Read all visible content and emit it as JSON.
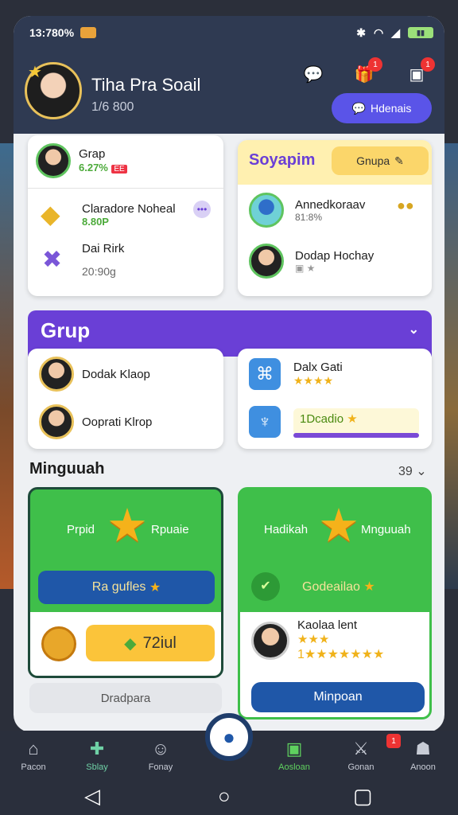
{
  "status_bar": {
    "time": "13:780%"
  },
  "profile": {
    "name": "Tiha Pra Soail",
    "subtitle": "1/6 800"
  },
  "header": {
    "action_label": "Hdenais",
    "badge_a": "1",
    "badge_b": "1"
  },
  "card_a": {
    "user_name": "Grap",
    "user_stat": "6.27%",
    "user_tag": "EE",
    "item1_title": "Claradore Noheal",
    "item1_sub": "8.80P",
    "item2_title": "Dai Rirk",
    "item2_sub": "20:90g"
  },
  "card_b": {
    "title": "Soyapim",
    "button": "Gnupa",
    "row1_name": "Annedkoraav",
    "row1_stat": "81:8%",
    "row2_name": "Dodap Hochay"
  },
  "group": {
    "title": "Grup",
    "members": [
      "Dodak Klaop",
      "Ooprati Klrop"
    ],
    "item1_title": "Dalx Gati",
    "item1_rating": "★★★★",
    "item2_title": "1Dcadio"
  },
  "section": {
    "title": "Minguuah",
    "count": "39"
  },
  "reward_left": {
    "label_left": "Prpid",
    "label_right": "Rpuaie",
    "button": "Ra gufles",
    "value": "72iul",
    "bottom_button": "Dradpara"
  },
  "reward_right": {
    "label_left": "Hadikah",
    "label_right": "Mnguuah",
    "subtitle": "Godeailao",
    "user_name": "Kaolaa lent",
    "rating_small": "★★★",
    "rating_row": "1★★★★★★★",
    "button": "Minpoan"
  },
  "nav": {
    "items": [
      "Pacon",
      "Sblay",
      "Fonay",
      "Aosloan",
      "Gonan",
      "Anoon"
    ],
    "badge": "1"
  }
}
